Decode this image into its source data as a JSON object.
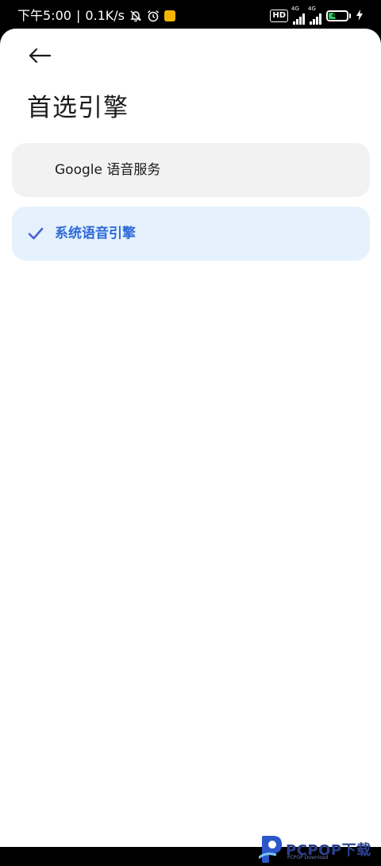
{
  "status_bar": {
    "time": "下午5:00",
    "separator": "|",
    "net_speed": "0.1K/s",
    "hd_label": "HD",
    "sim1_network": "4G",
    "sim2_network": "4G",
    "battery_level": "41",
    "battery_fraction": 0.41,
    "icons": [
      "mute-bell-icon",
      "alarm-icon",
      "app-notification-icon",
      "signal-icon",
      "battery-icon",
      "charging-icon"
    ]
  },
  "header": {
    "back_icon": "back-arrow-icon",
    "title": "首选引擎"
  },
  "options": [
    {
      "label": "Google 语音服务",
      "selected": false
    },
    {
      "label": "系统语音引擎",
      "selected": true
    }
  ],
  "colors": {
    "selected_bg": "#e5f1fd",
    "selected_text": "#2f6ad8",
    "unselected_bg": "#f2f2f2",
    "check": "#4a5fd6"
  },
  "watermark": {
    "brand": "PCPOP下载",
    "sub": "PCPOP Download"
  }
}
